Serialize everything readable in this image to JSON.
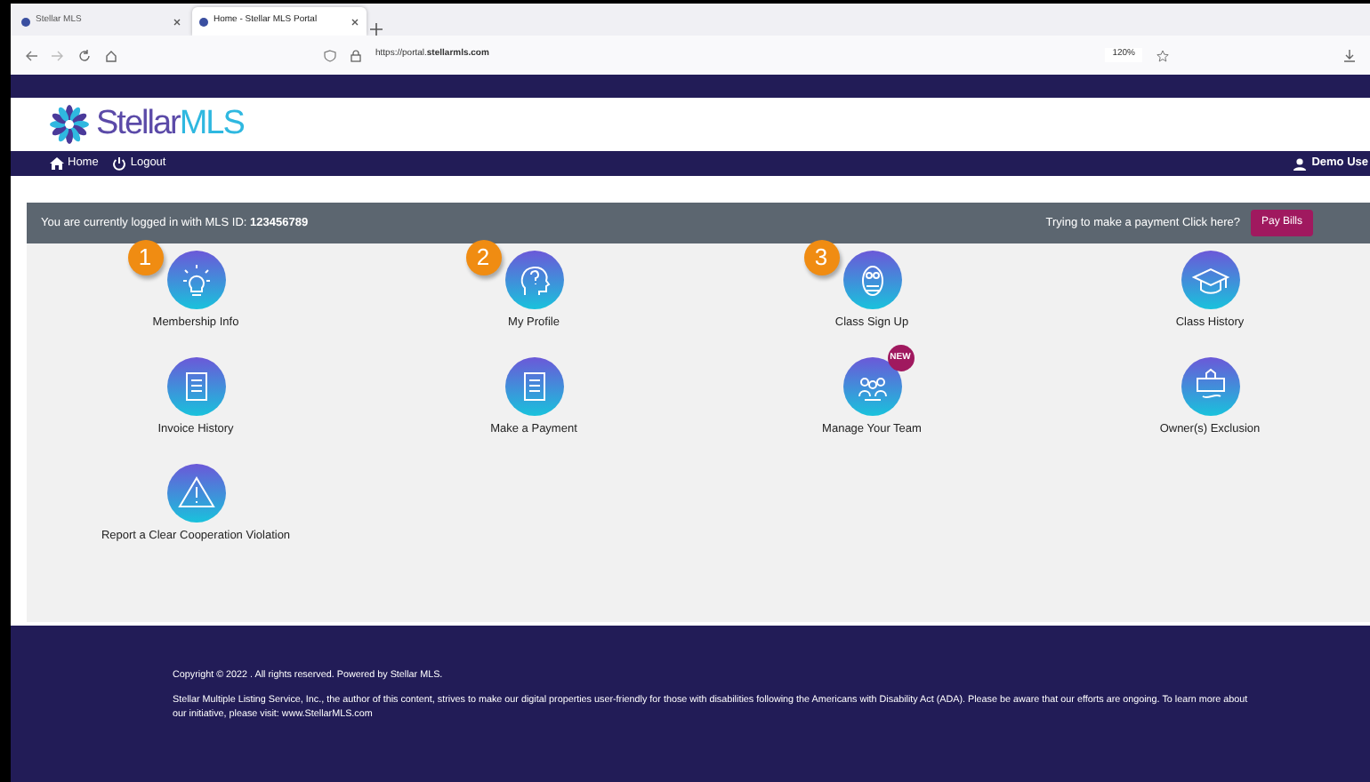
{
  "browser": {
    "tabs": [
      {
        "title": "Stellar MLS",
        "selected": false
      },
      {
        "title": "Home - Stellar MLS Portal",
        "selected": true
      }
    ],
    "url_prefix": "https://portal.",
    "url_domain": "stellarmls.com",
    "zoom": "120%"
  },
  "brand": {
    "name": "Stellar",
    "suffix": "MLS"
  },
  "nav": [
    {
      "label": "Home",
      "kind": "home"
    },
    {
      "label": "Logout",
      "kind": "power"
    }
  ],
  "user": "Demo Use",
  "banner": {
    "text": "You are currently logged in with MLS ID: **123456789**",
    "prompt": "Trying to make a payment Click here?",
    "button": "Pay Bills"
  },
  "tiles": [
    {
      "label": "Membership Info",
      "kind": "bulb",
      "callout": "1"
    },
    {
      "label": "My Profile",
      "kind": "head",
      "callout": "2"
    },
    {
      "label": "Class Sign Up",
      "kind": "owl",
      "callout": "3"
    },
    {
      "label": "Class History",
      "kind": "cap"
    },
    {
      "label": "Invoice History",
      "kind": "document"
    },
    {
      "label": "Make a Payment",
      "kind": "document"
    },
    {
      "label": "Manage Your Team",
      "kind": "team",
      "badge": "NEW"
    },
    {
      "label": "Owner(s) Exclusion",
      "kind": "sign"
    },
    {
      "label": "Report a Clear Cooperation Violation",
      "kind": "warning"
    }
  ],
  "footer": {
    "copyright": "Copyright © 2022 .  All rights reserved. Powered by Stellar MLS.",
    "notice": "Stellar Multiple Listing Service, Inc., the author of this content, strives to make our digital properties user-friendly for those with disabilities following the Americans with Disability Act (ADA). Please be aware that our efforts are ongoing. To learn more about our initiative, please visit:",
    "link": "www.StellarMLS.com"
  }
}
